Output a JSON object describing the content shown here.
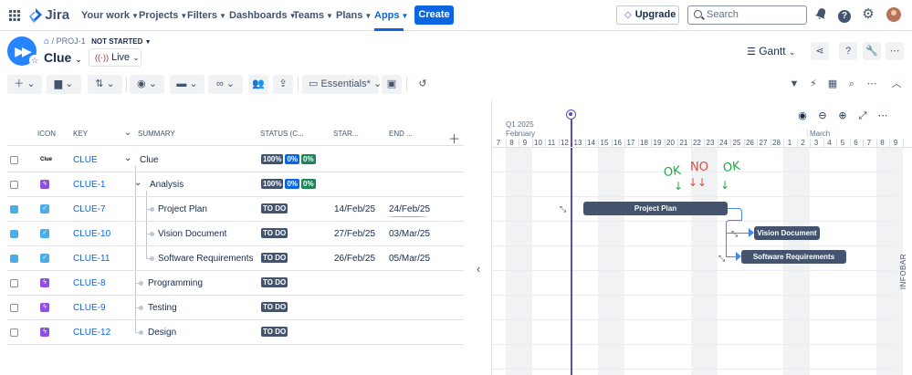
{
  "topnav": {
    "logo_text": "Jira",
    "items": [
      {
        "label": "Your work"
      },
      {
        "label": "Projects"
      },
      {
        "label": "Filters"
      },
      {
        "label": "Dashboards"
      },
      {
        "label": "Teams"
      },
      {
        "label": "Plans"
      },
      {
        "label": "Apps"
      }
    ],
    "create_label": "Create",
    "upgrade_label": "Upgrade",
    "search_placeholder": "Search",
    "accent": "#0c66e4"
  },
  "project": {
    "breadcrumb": "/ PROJ-1",
    "status": "NOT STARTED",
    "title": "Clue",
    "live_label": "Live",
    "view_label": "Gantt"
  },
  "toolbar": {
    "view_label": "Essentials",
    "view_modified": "*"
  },
  "grid": {
    "columns": {
      "icon": "ICON",
      "key": "KEY",
      "summary": "SUMMARY",
      "status": "STATUS (C...",
      "start": "STAR...",
      "end": "END ..."
    },
    "rows": [
      {
        "key": "CLUE",
        "summary": "Clue",
        "status": [
          "100%",
          "0%",
          "0%"
        ],
        "start": "",
        "end": "",
        "type": "project"
      },
      {
        "key": "CLUE-1",
        "summary": "Analysis",
        "status": [
          "100%",
          "0%",
          "0%"
        ],
        "start": "",
        "end": "",
        "type": "epic"
      },
      {
        "key": "CLUE-7",
        "summary": "Project Plan",
        "status": [
          "TO DO"
        ],
        "start": "14/Feb/25",
        "end": "24/Feb/25",
        "type": "task"
      },
      {
        "key": "CLUE-10",
        "summary": "Vision Document",
        "status": [
          "TO DO"
        ],
        "start": "27/Feb/25",
        "end": "03/Mar/25",
        "type": "task"
      },
      {
        "key": "CLUE-11",
        "summary": "Software Requirements",
        "status": [
          "TO DO"
        ],
        "start": "26/Feb/25",
        "end": "05/Mar/25",
        "type": "task"
      },
      {
        "key": "CLUE-8",
        "summary": "Programming",
        "status": [
          "TO DO"
        ],
        "start": "",
        "end": "",
        "type": "epic"
      },
      {
        "key": "CLUE-9",
        "summary": "Testing",
        "status": [
          "TO DO"
        ],
        "start": "",
        "end": "",
        "type": "epic"
      },
      {
        "key": "CLUE-12",
        "summary": "Design",
        "status": [
          "TO DO"
        ],
        "start": "",
        "end": "",
        "type": "epic"
      }
    ]
  },
  "gantt": {
    "quarter": "Q1 2025",
    "months": [
      "February",
      "March"
    ],
    "days": [
      "7",
      "8",
      "9",
      "10",
      "11",
      "12",
      "13",
      "14",
      "15",
      "16",
      "17",
      "18",
      "19",
      "20",
      "21",
      "22",
      "23",
      "24",
      "25",
      "26",
      "27",
      "28",
      "1",
      "2",
      "3",
      "4",
      "5",
      "6",
      "7",
      "8",
      "9"
    ],
    "bars": [
      {
        "label": "Project Plan"
      },
      {
        "label": "Vision Document"
      },
      {
        "label": "Software Requirements"
      }
    ],
    "annotations": [
      {
        "text": "OK",
        "kind": "ok"
      },
      {
        "text": "NO",
        "kind": "no"
      },
      {
        "text": "OK",
        "kind": "ok"
      }
    ],
    "infobar_label": "INFOBAR"
  }
}
